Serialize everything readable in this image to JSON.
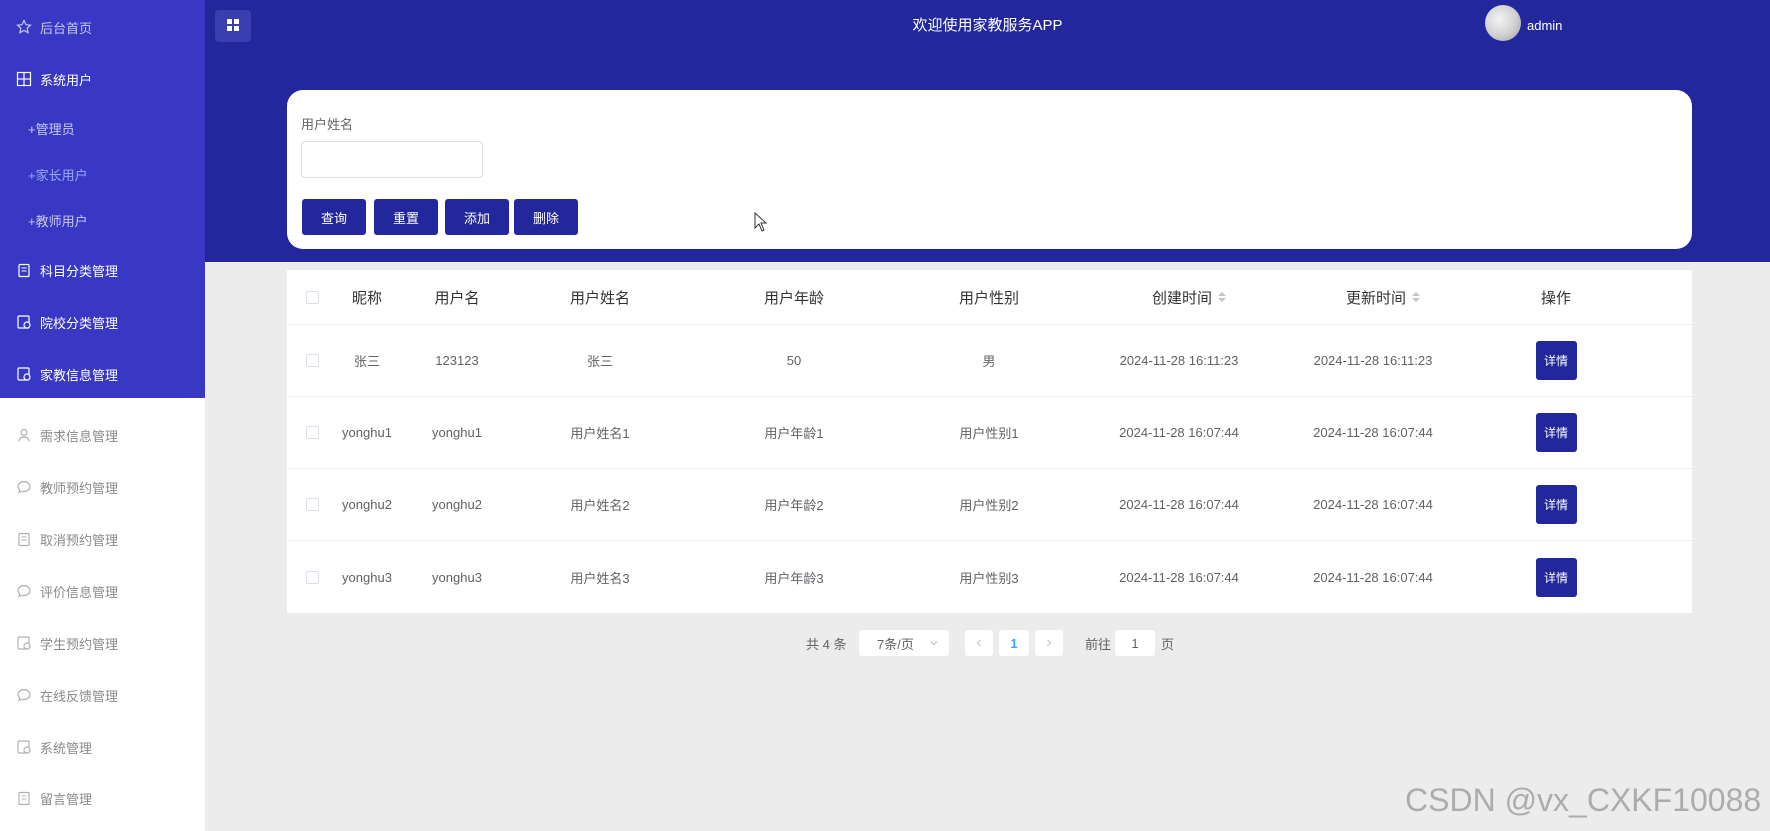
{
  "sidebar": {
    "items": [
      {
        "label": "后台首页",
        "icon": "star-icon"
      },
      {
        "label": "系统用户",
        "icon": "grid-icon"
      },
      {
        "label": "+管理员",
        "icon": ""
      },
      {
        "label": "+家长用户",
        "icon": ""
      },
      {
        "label": "+教师用户",
        "icon": ""
      },
      {
        "label": "科目分类管理",
        "icon": "clipboard-icon"
      },
      {
        "label": "院校分类管理",
        "icon": "document-icon"
      },
      {
        "label": "家教信息管理",
        "icon": "document-icon"
      },
      {
        "label": "需求信息管理",
        "icon": "user-icon"
      },
      {
        "label": "教师预约管理",
        "icon": "chat-icon"
      },
      {
        "label": "取消预约管理",
        "icon": "clipboard-icon"
      },
      {
        "label": "评价信息管理",
        "icon": "chat-icon"
      },
      {
        "label": "学生预约管理",
        "icon": "document-icon"
      },
      {
        "label": "在线反馈管理",
        "icon": "chat-icon"
      },
      {
        "label": "系统管理",
        "icon": "document-icon"
      },
      {
        "label": "留言管理",
        "icon": "clipboard-icon"
      }
    ]
  },
  "header": {
    "title": "欢迎使用家教服务APP",
    "username": "admin"
  },
  "search": {
    "label": "用户姓名",
    "value": "",
    "placeholder": "",
    "buttons": {
      "query": "查询",
      "reset": "重置",
      "add": "添加",
      "delete": "删除"
    }
  },
  "table": {
    "columns": [
      "昵称",
      "用户名",
      "用户姓名",
      "用户年龄",
      "用户性别",
      "创建时间",
      "更新时间",
      "操作"
    ],
    "rows": [
      [
        "张三",
        "123123",
        "张三",
        "50",
        "男",
        "2024-11-28 16:11:23",
        "2024-11-28 16:11:23",
        "详情"
      ],
      [
        "yonghu1",
        "yonghu1",
        "用户姓名1",
        "用户年龄1",
        "用户性别1",
        "2024-11-28 16:07:44",
        "2024-11-28 16:07:44",
        "详情"
      ],
      [
        "yonghu2",
        "yonghu2",
        "用户姓名2",
        "用户年龄2",
        "用户性别2",
        "2024-11-28 16:07:44",
        "2024-11-28 16:07:44",
        "详情"
      ],
      [
        "yonghu3",
        "yonghu3",
        "用户姓名3",
        "用户年龄3",
        "用户性别3",
        "2024-11-28 16:07:44",
        "2024-11-28 16:07:44",
        "详情"
      ]
    ]
  },
  "pagination": {
    "total": "共 4 条",
    "page_size": "7条/页",
    "current_page": "1",
    "goto_label": "前往",
    "goto_value": "1",
    "page_suffix": "页"
  },
  "watermark": "CSDN @vx_CXKF10088",
  "colors": {
    "sidebar_accent": "#3838c4",
    "header": "#22279c",
    "button": "#22279c"
  }
}
